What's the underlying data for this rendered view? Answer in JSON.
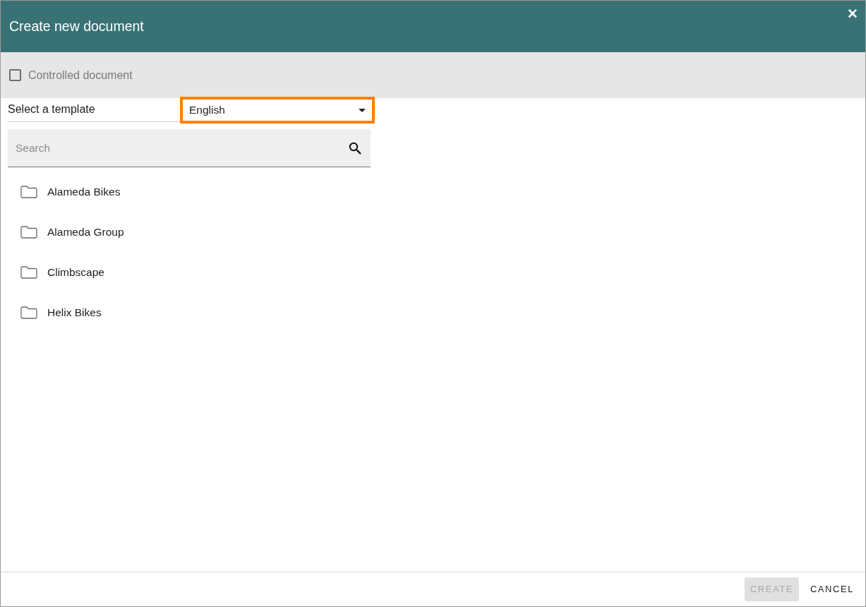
{
  "dialog": {
    "title": "Create new document",
    "close": "✕"
  },
  "controlled_document": {
    "label": "Controlled document",
    "checked": false
  },
  "template": {
    "label": "Select a template",
    "language": {
      "value": "English",
      "highlighted": true
    }
  },
  "search": {
    "placeholder": "Search"
  },
  "folders": [
    {
      "name": "Alameda Bikes"
    },
    {
      "name": "Alameda Group"
    },
    {
      "name": "Climbscape"
    },
    {
      "name": "Helix Bikes"
    }
  ],
  "buttons": [
    {
      "label": "CREATE",
      "disabled": true
    },
    {
      "label": "CANCEL",
      "disabled": false
    }
  ]
}
